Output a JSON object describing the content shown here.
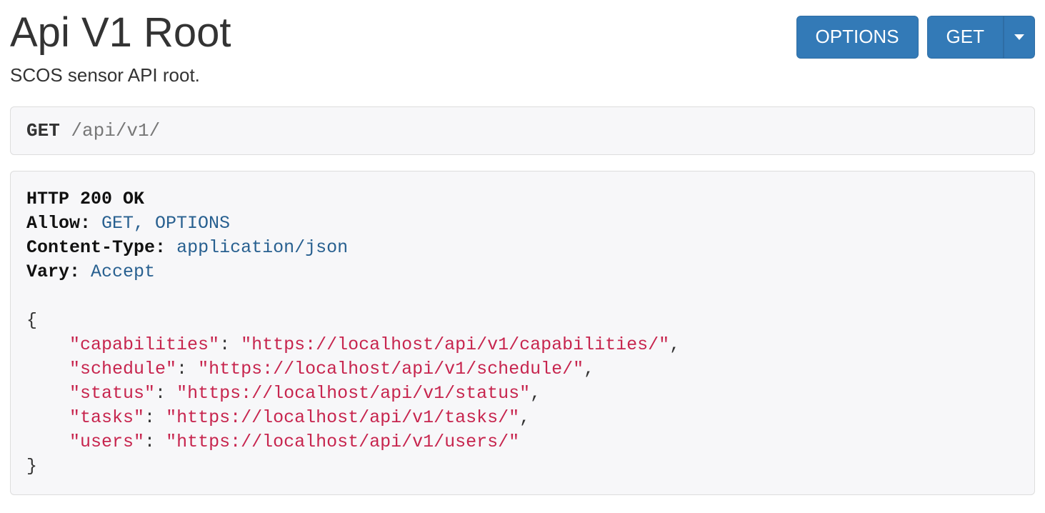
{
  "header": {
    "title": "Api V1 Root",
    "description": "SCOS sensor API root.",
    "buttons": {
      "options_label": "OPTIONS",
      "get_label": "GET"
    }
  },
  "request": {
    "method": "GET",
    "path": "/api/v1/"
  },
  "response": {
    "status_line": "HTTP 200 OK",
    "headers": [
      {
        "name": "Allow",
        "value": "GET, OPTIONS"
      },
      {
        "name": "Content-Type",
        "value": "application/json"
      },
      {
        "name": "Vary",
        "value": "Accept"
      }
    ],
    "body": {
      "capabilities": "https://localhost/api/v1/capabilities/",
      "schedule": "https://localhost/api/v1/schedule/",
      "status": "https://localhost/api/v1/status",
      "tasks": "https://localhost/api/v1/tasks/",
      "users": "https://localhost/api/v1/users/"
    }
  }
}
